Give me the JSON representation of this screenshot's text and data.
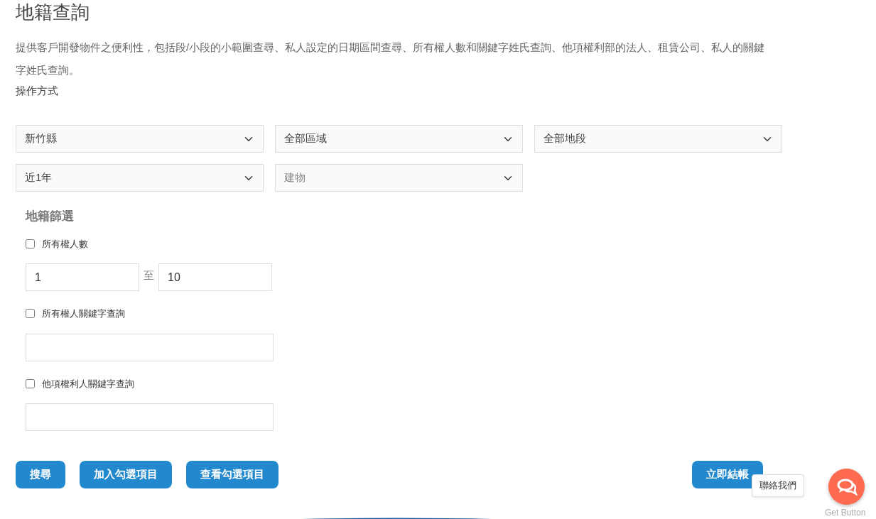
{
  "page_title": "地籍查詢",
  "description": "提供客戶開發物件之便利性，包括段/小段的小範圍查尋、私人設定的日期區間查尋、所有權人數和關鍵字姓氏查詢、他項權利部的法人、租賃公司、私人的關鍵字姓氏查詢。",
  "instructions_link": "操作方式",
  "selects": [
    {
      "value": "新竹縣",
      "disabled": false
    },
    {
      "value": "全部區域",
      "disabled": false
    },
    {
      "value": "全部地段",
      "disabled": false
    },
    {
      "value": "近1年",
      "disabled": false
    },
    {
      "value": "建物",
      "disabled": true
    }
  ],
  "filter": {
    "heading": "地籍篩選",
    "owner_count": {
      "label": "所有權人數",
      "checked": false,
      "from": "1",
      "separator": "至",
      "to": "10"
    },
    "owner_keyword": {
      "label": "所有權人關鍵字查詢",
      "checked": false
    },
    "other_rights_keyword": {
      "label": "他項權利人關鍵字查詢",
      "checked": false
    }
  },
  "buttons": [
    "搜尋",
    "加入勾選項目",
    "查看勾選項目"
  ],
  "checkout_button": "立即結帳",
  "chat_widget": {
    "tooltip": "聯絡我們",
    "caption": "Get Button"
  }
}
